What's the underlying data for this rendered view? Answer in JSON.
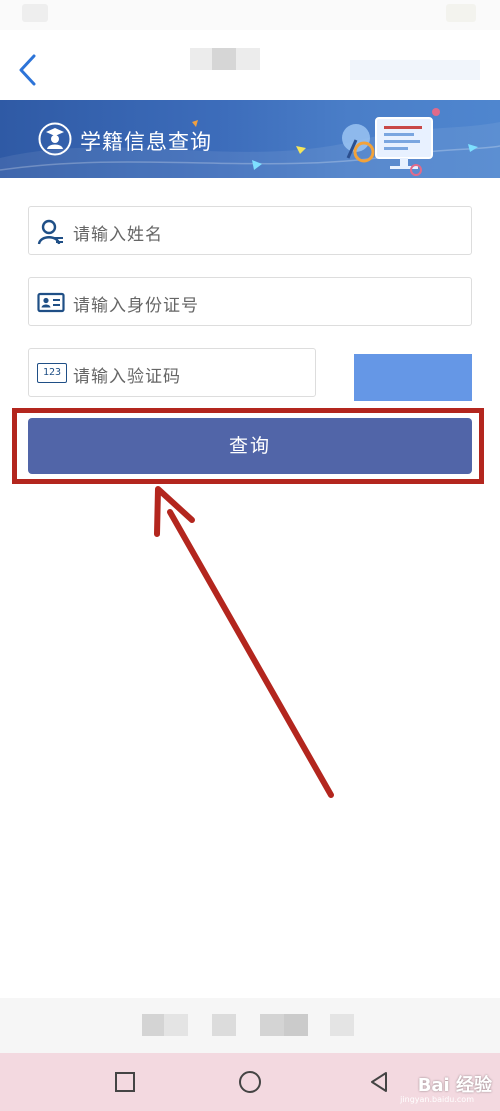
{
  "banner": {
    "title": "学籍信息查询"
  },
  "form": {
    "name_placeholder": "请输入姓名",
    "id_placeholder": "请输入身份证号",
    "code_placeholder": "请输入验证码",
    "code_icon_text": "123",
    "submit_label": "查询"
  },
  "watermark": {
    "brand": "Bai 经验",
    "url": "jingyan.baidu.com"
  },
  "colors": {
    "banner": "#3d6dbb",
    "button": "#5165a8",
    "captcha": "#6597e6",
    "highlight": "#b3261e",
    "nav_bar": "#f3d9e0"
  }
}
